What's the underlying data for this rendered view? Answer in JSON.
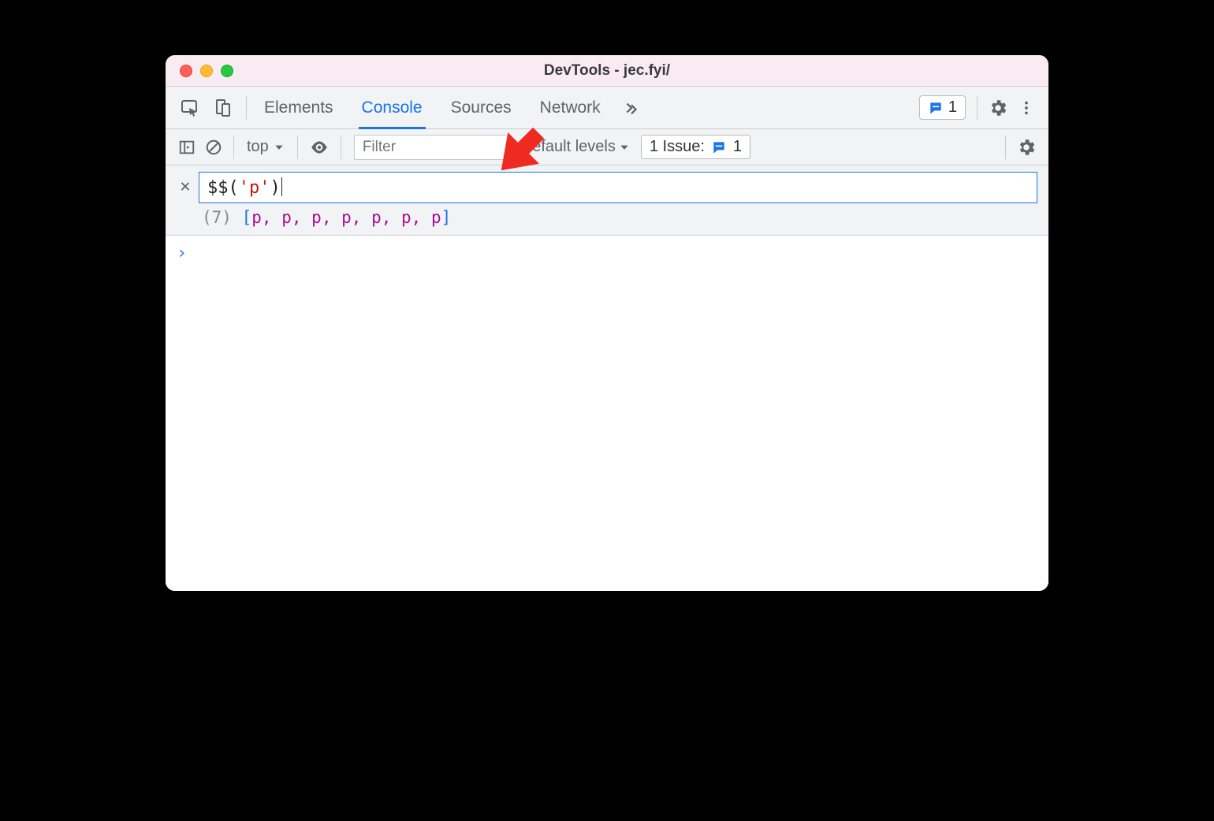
{
  "window": {
    "title": "DevTools - jec.fyi/"
  },
  "tabs": {
    "items": [
      "Elements",
      "Console",
      "Sources",
      "Network"
    ],
    "active_index": 1,
    "feedback_count": "1"
  },
  "console_toolbar": {
    "context_label": "top",
    "filter_placeholder": "Filter",
    "levels_label": "Default levels",
    "issues": {
      "label": "1 Issue:",
      "count": "1"
    }
  },
  "eager_eval": {
    "input_tokens": {
      "dollar": "$$",
      "open": "(",
      "str": "'p'",
      "close": ")"
    },
    "preview": {
      "count": "(7)",
      "open": "[",
      "items": [
        "p",
        "p",
        "p",
        "p",
        "p",
        "p",
        "p"
      ],
      "close": "]"
    }
  }
}
